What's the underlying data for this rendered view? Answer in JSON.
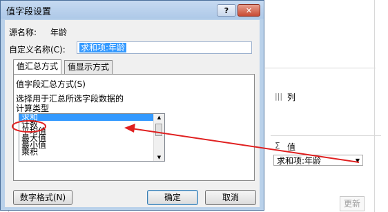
{
  "dialog": {
    "title": "值字段设置",
    "help_label": "?",
    "close_label": "✕",
    "source_label": "源名称:",
    "source_value": "年龄",
    "custom_label": "自定义名称(C):",
    "custom_value": "求和项:年龄",
    "tabs": [
      {
        "label": "值汇总方式"
      },
      {
        "label": "值显示方式"
      }
    ],
    "section_title": "值字段汇总方式(S)",
    "desc_line1": "选择用于汇总所选字段数据的",
    "desc_line2": "计算类型",
    "list_items": [
      {
        "label": "求和"
      },
      {
        "label": "计数"
      },
      {
        "label": "平均值"
      },
      {
        "label": "最大值"
      },
      {
        "label": "最小值"
      },
      {
        "label": "乘积"
      }
    ],
    "number_format_label": "数字格式(N)",
    "ok_label": "确定",
    "cancel_label": "取消"
  },
  "pivot_pane": {
    "columns_icon": "columns-icon",
    "columns_label": "列",
    "values_icon": "sigma-icon",
    "values_label": "值",
    "value_field": "求和项:年龄",
    "update_label": "更新"
  },
  "annotation": {
    "color": "#e02020"
  }
}
